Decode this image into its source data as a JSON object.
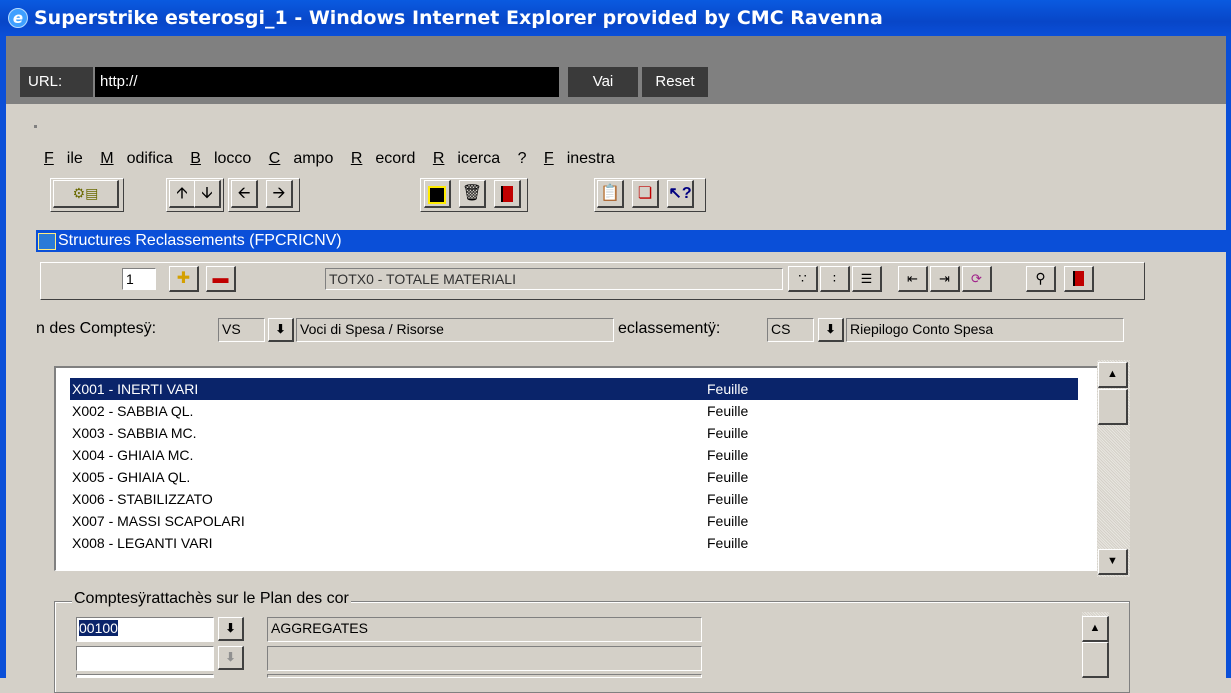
{
  "window": {
    "title": "Superstrike esterosgi_1 - Windows Internet Explorer provided by CMC Ravenna"
  },
  "urlbar": {
    "label": "URL:",
    "value": "http://",
    "go_label": "Vai",
    "reset_label": "Reset"
  },
  "menu": [
    {
      "label": "File",
      "underline": "F",
      "rest": "ile"
    },
    {
      "label": "Modifica",
      "underline": "M",
      "rest": "odifica"
    },
    {
      "label": "Blocco",
      "underline": "B",
      "rest": "locco"
    },
    {
      "label": "Campo",
      "underline": "C",
      "rest": "ampo"
    },
    {
      "label": "Record",
      "underline": "R",
      "rest": "ecord"
    },
    {
      "label": "Ricerca",
      "underline": "R",
      "rest": "icerca"
    },
    {
      "label": "?",
      "underline": "",
      "rest": "?"
    },
    {
      "label": "Finestra",
      "underline": "F",
      "rest": "inestra"
    }
  ],
  "toolbar": {
    "icons": [
      "enter-query-icon",
      "arrow-up-icon",
      "arrow-down-icon",
      "arrow-left-icon",
      "arrow-right-icon",
      "save-icon",
      "delete-icon",
      "exit-icon",
      "clipboard-icon",
      "copy-icon",
      "help-icon"
    ]
  },
  "form": {
    "title": "Structures Reclassements (FPCRICNV)",
    "record_number": "1",
    "current_node": "TOTX0 - TOTALE MATERIALI"
  },
  "filters": {
    "plan_label": "n des Comptesÿ:",
    "plan_code": "VS",
    "plan_desc": "Voci di Spesa / Risorse",
    "reclass_label": "eclassementÿ:",
    "reclass_code": "CS",
    "reclass_desc": "Riepilogo Conto Spesa"
  },
  "list": {
    "rows": [
      {
        "code": "X001 - INERTI VARI",
        "type": "Feuille"
      },
      {
        "code": "X002 - SABBIA QL.",
        "type": "Feuille"
      },
      {
        "code": "X003 - SABBIA MC.",
        "type": "Feuille"
      },
      {
        "code": "X004 - GHIAIA MC.",
        "type": "Feuille"
      },
      {
        "code": "X005 - GHIAIA QL.",
        "type": "Feuille"
      },
      {
        "code": "X006 - STABILIZZATO",
        "type": "Feuille"
      },
      {
        "code": "X007 - MASSI SCAPOLARI",
        "type": "Feuille"
      },
      {
        "code": "X008 - LEGANTI VARI",
        "type": "Feuille"
      }
    ]
  },
  "accounts": {
    "title": "Comptesÿrattachès sur le Plan des cor",
    "rows": [
      {
        "code": "00100",
        "desc": "AGGREGATES"
      },
      {
        "code": "",
        "desc": ""
      },
      {
        "code": "",
        "desc": ""
      }
    ]
  },
  "colors": {
    "selection": "#0a246a",
    "titlebar": "#0a4fd8"
  }
}
